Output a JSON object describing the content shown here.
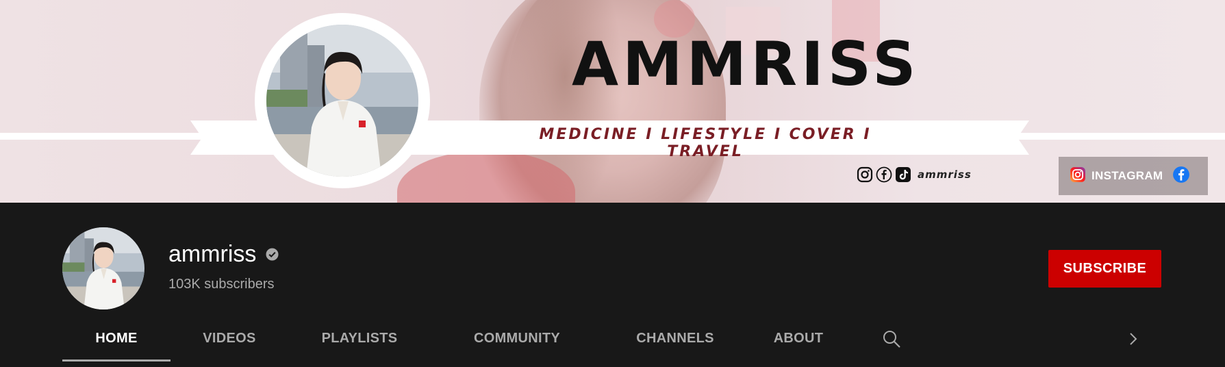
{
  "banner": {
    "title": "AMMRISS",
    "tagline": "MEDICINE I LIFESTYLE I COVER I TRAVEL",
    "social_icons": [
      "instagram-icon",
      "facebook-icon",
      "tiktok-icon"
    ],
    "handle": "ammriss",
    "links": [
      {
        "label": "INSTAGRAM",
        "icon": "instagram-icon"
      },
      {
        "label": "",
        "icon": "facebook-icon"
      }
    ]
  },
  "channel": {
    "name": "ammriss",
    "verified": true,
    "subscribers": "103K subscribers",
    "subscribe_label": "SUBSCRIBE"
  },
  "tabs": [
    {
      "label": "HOME",
      "active": true
    },
    {
      "label": "VIDEOS",
      "active": false
    },
    {
      "label": "PLAYLISTS",
      "active": false
    },
    {
      "label": "COMMUNITY",
      "active": false
    },
    {
      "label": "CHANNELS",
      "active": false
    },
    {
      "label": "ABOUT",
      "active": false
    }
  ],
  "tab_icons": [
    "search-icon",
    "chevron-right-icon"
  ],
  "colors": {
    "background": "#181818",
    "subscribe": "#cc0000",
    "tagline": "#7a1e25",
    "subtext": "#aaaaaa"
  }
}
